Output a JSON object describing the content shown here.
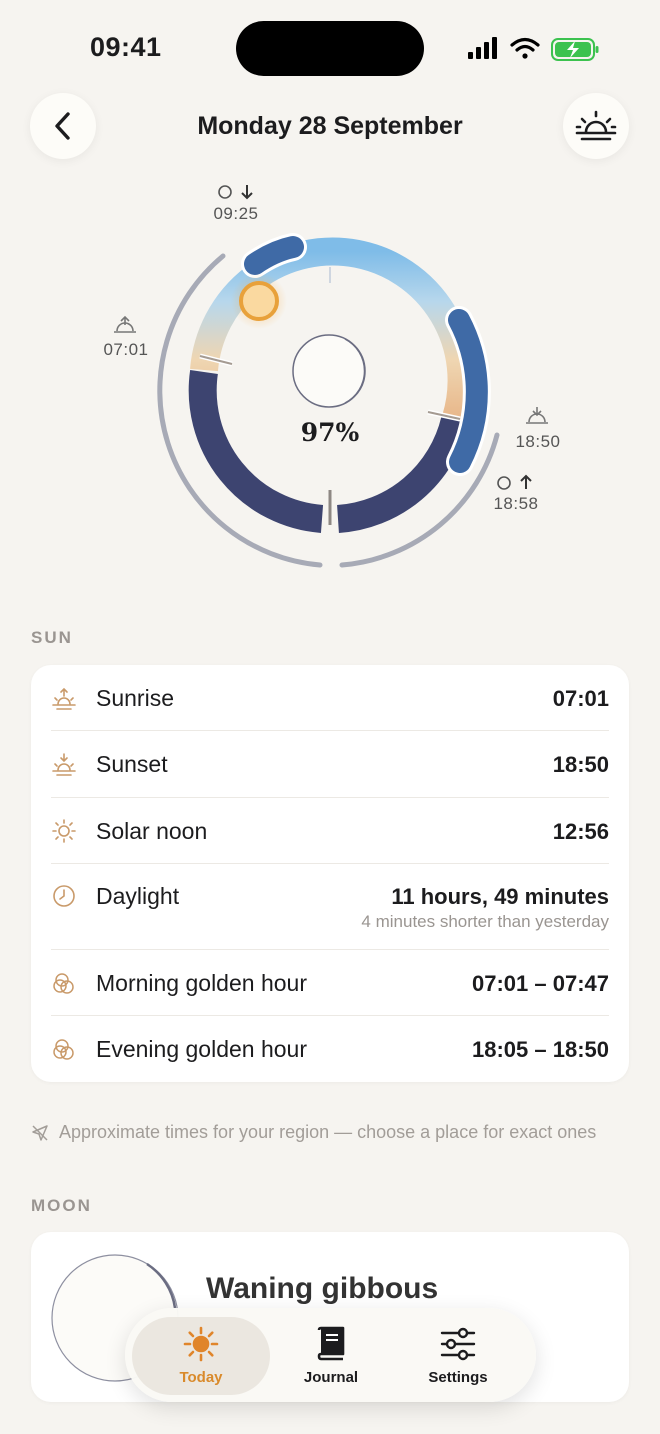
{
  "status_bar": {
    "time": "09:41"
  },
  "header": {
    "title": "Monday 28 September"
  },
  "dial": {
    "moonset_time": "09:25",
    "sunrise_time": "07:01",
    "sunset_time": "18:50",
    "moonrise_time": "18:58",
    "percent": "97%"
  },
  "sun": {
    "section_label": "SUN",
    "rows": [
      {
        "label": "Sunrise",
        "value": "07:01",
        "icon": "sunrise-icon"
      },
      {
        "label": "Sunset",
        "value": "18:50",
        "icon": "sunset-icon"
      },
      {
        "label": "Solar noon",
        "value": "12:56",
        "icon": "sun-icon"
      },
      {
        "label": "Daylight",
        "value": "11 hours, 49 minutes",
        "sub": "4 minutes shorter than yesterday",
        "icon": "clock-icon"
      },
      {
        "label": "Morning golden hour",
        "value": "07:01 – 07:47",
        "icon": "golden-hour-icon"
      },
      {
        "label": "Evening golden hour",
        "value": "18:05 – 18:50",
        "icon": "golden-hour-icon"
      }
    ],
    "note": "Approximate times for your region — choose a place for exact ones"
  },
  "moon": {
    "section_label": "MOON",
    "phase": "Waning gibbous",
    "illumination_fraction": 0.97
  },
  "tabs": [
    {
      "label": "Today",
      "icon": "sun-icon",
      "active": true
    },
    {
      "label": "Journal",
      "icon": "book-icon",
      "active": false
    },
    {
      "label": "Settings",
      "icon": "sliders-icon",
      "active": false
    }
  ],
  "colors": {
    "accent": "#d98a2b",
    "night": "#3d4470",
    "day": "#8cc4e6",
    "moon_arc": "#3f6aa6",
    "background": "#f6f4f0"
  }
}
